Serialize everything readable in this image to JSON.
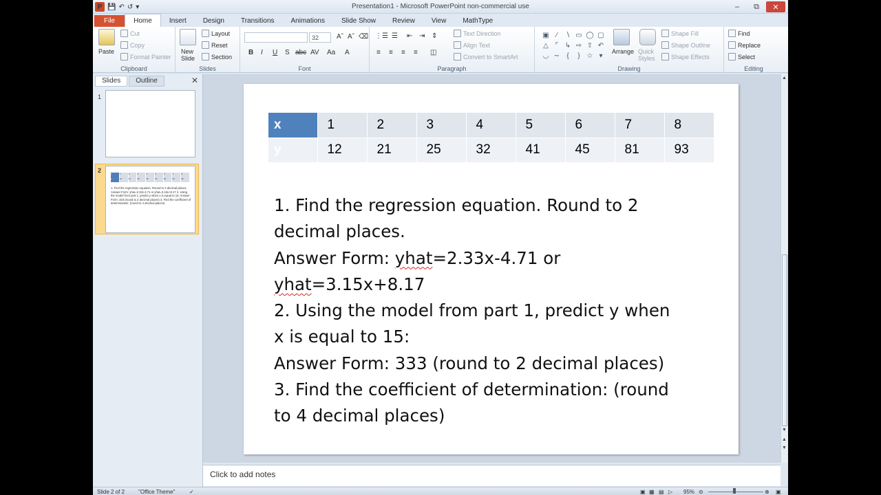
{
  "window": {
    "title": "Presentation1 - Microsoft PowerPoint non-commercial use",
    "app_icon": "P",
    "buttons": [
      "–",
      "⧉",
      "✕"
    ]
  },
  "tabs": [
    "File",
    "Home",
    "Insert",
    "Design",
    "Transitions",
    "Animations",
    "Slide Show",
    "Review",
    "View",
    "MathType"
  ],
  "active_tab": "Home",
  "ribbon": {
    "clipboard": {
      "label": "Clipboard",
      "paste": "Paste",
      "cut": "Cut",
      "copy": "Copy",
      "format_painter": "Format Painter"
    },
    "slides": {
      "label": "Slides",
      "new_slide_line1": "New",
      "new_slide_line2": "Slide",
      "layout": "Layout",
      "reset": "Reset",
      "section": "Section"
    },
    "font": {
      "label": "Font",
      "size": "32"
    },
    "paragraph": {
      "label": "Paragraph",
      "text_direction": "Text Direction",
      "align_text": "Align Text",
      "convert_smartart": "Convert to SmartArt"
    },
    "drawing": {
      "label": "Drawing",
      "arrange": "Arrange",
      "quick_styles_line1": "Quick",
      "quick_styles_line2": "Styles",
      "shape_fill": "Shape Fill",
      "shape_outline": "Shape Outline",
      "shape_effects": "Shape Effects"
    },
    "editing": {
      "label": "Editing",
      "find": "Find",
      "replace": "Replace",
      "select": "Select"
    }
  },
  "left_pane": {
    "tabs": [
      "Slides",
      "Outline"
    ],
    "close": "✕",
    "slides": [
      {
        "number": "1"
      },
      {
        "number": "2",
        "preview_text": "1. Find the regression equation. Round to 2 decimal places. Answer Form: yhat=2.33x-4.71 or yhat=3.15x+8.17 2. Using the model from part 1, predict y when x is equal to 15: Answer Form: 333 (round to 2 decimal places) 3. Find the coefficient of determination: (round to 4 decimal places)"
      }
    ]
  },
  "slide": {
    "table": {
      "x_label": "x",
      "y_label": "y",
      "x": [
        "1",
        "2",
        "3",
        "4",
        "5",
        "6",
        "7",
        "8"
      ],
      "y": [
        "12",
        "21",
        "25",
        "32",
        "41",
        "45",
        "81",
        "93"
      ]
    },
    "lines": {
      "l1": "1.  Find the regression equation.  Round to 2",
      "l2": "decimal places.",
      "l3a": "Answer Form: ",
      "l3b": "yhat",
      "l3c": "=2.33x-4.71  or",
      "l4a": "yhat",
      "l4b": "=3.15x+8.17",
      "l5": "2.  Using the model from part 1, predict y when",
      "l6": "x is equal to 15:",
      "l7": "Answer Form: 333   (round to 2 decimal places)",
      "l8": "3.  Find the coefficient of determination:  (round",
      "l9": "to 4 decimal places)"
    }
  },
  "notes_placeholder": "Click to add notes",
  "status": {
    "slide": "Slide 2 of 2",
    "theme": "\"Office Theme\"",
    "zoom": "95%"
  }
}
